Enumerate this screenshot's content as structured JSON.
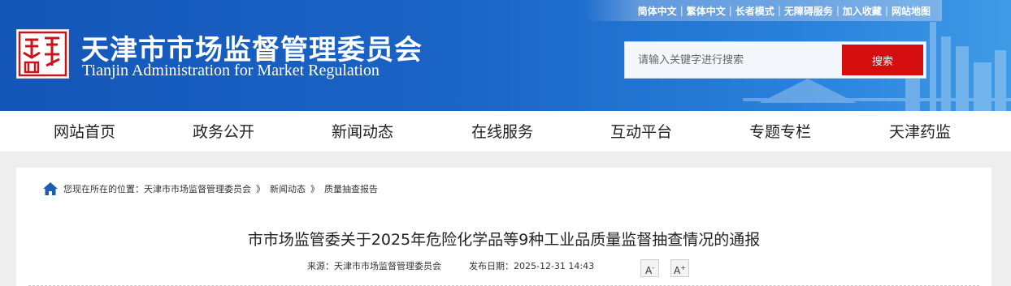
{
  "topbar": {
    "links": [
      "简体中文",
      "繁体中文",
      "长者模式",
      "无障碍服务",
      "加入收藏",
      "网站地图"
    ]
  },
  "logo": {
    "alt_text": "天津政务网"
  },
  "site": {
    "title_cn": "天津市市场监督管理委员会",
    "title_en": "Tianjin Administration for Market Regulation"
  },
  "search": {
    "placeholder": "请输入关键字进行搜索",
    "button_label": "搜索"
  },
  "nav": {
    "items": [
      "网站首页",
      "政务公开",
      "新闻动态",
      "在线服务",
      "互动平台",
      "专题专栏",
      "天津药监"
    ]
  },
  "breadcrumb": {
    "prefix": "您现在所在的位置：",
    "items": [
      "天津市市场监督管理委员会",
      "新闻动态",
      "质量抽查报告"
    ],
    "separator": "》"
  },
  "article": {
    "title": "市市场监管委关于2025年危险化学品等9种工业品质量监督抽查情况的通报",
    "source": "来源：天津市市场监督管理委员会",
    "date": "发布日期：2025-12-31 14:43",
    "font_decrease_label": "A",
    "font_increase_label": "A",
    "font_decrease_mark": "-",
    "font_increase_mark": "+"
  },
  "colors": {
    "header_blue": "#1456b8",
    "search_red": "#d40e0e"
  }
}
